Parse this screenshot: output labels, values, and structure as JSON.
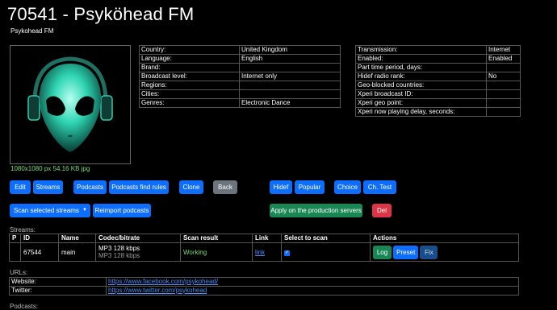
{
  "page": {
    "title": "70541 - Psyköhead FM",
    "subtitle": "Psykohead FM",
    "image_info": "1080x1080 px 54.16 KB jpg"
  },
  "info_left": [
    {
      "label": "Country:",
      "value": "United Kingdom"
    },
    {
      "label": "Language:",
      "value": "English"
    },
    {
      "label": "Brand:",
      "value": ""
    },
    {
      "label": "Broadcast level:",
      "value": "Internet only"
    },
    {
      "label": "Regions:",
      "value": ""
    },
    {
      "label": "Cities:",
      "value": ""
    },
    {
      "label": "Genres:",
      "value": "Electronic Dance"
    }
  ],
  "info_right": [
    {
      "label": "Transmission:",
      "value": "Internet"
    },
    {
      "label": "Enabled:",
      "value": "Enabled"
    },
    {
      "label": "Part time period, days:",
      "value": ""
    },
    {
      "label": "Hidef radio rank:",
      "value": "No"
    },
    {
      "label": "Geo-blocked countries:",
      "value": ""
    },
    {
      "label": "Xperi broadcast ID:",
      "value": ""
    },
    {
      "label": "Xperi geo point:",
      "value": ""
    },
    {
      "label": "Xperi now playing delay, seconds:",
      "value": ""
    }
  ],
  "buttons_row1": {
    "edit": "Edit",
    "streams": "Streams",
    "podcasts": "Podcasts",
    "podcasts_find_rules": "Podcasts find rules",
    "clone": "Clone",
    "back": "Back",
    "hidef": "Hidef",
    "popular": "Popular",
    "choice": "Choice",
    "ch_test": "Ch. Test"
  },
  "buttons_row2": {
    "scan_selected": "Scan selected streams",
    "reimport_podcasts": "Reimport podcasts",
    "apply_production": "Apply on the production servers",
    "del": "Del"
  },
  "streams": {
    "section_label": "Streams:",
    "headers": [
      "P",
      "ID",
      "Name",
      "Codec/bitrate",
      "Scan result",
      "Link",
      "Select to scan",
      "Actions"
    ],
    "rows": [
      {
        "p": "",
        "id": "67544",
        "name": "main",
        "codec1": "MP3 128 kbps",
        "codec2": "MP3 128 kbps",
        "scan_result": "Working",
        "link": "link",
        "actions": {
          "log": "Log",
          "preset": "Preset",
          "fix": "Fix"
        }
      }
    ]
  },
  "urls": {
    "section_label": "URLs:",
    "rows": [
      {
        "label": "Website:",
        "value": "https://www.facebook.com/psykohead/"
      },
      {
        "label": "Twitter:",
        "value": "https://www.twitter.com/psykohead"
      }
    ]
  },
  "podcasts": {
    "section_label": "Podcasts:"
  },
  "colors": {
    "background": "#000000",
    "primary_button": "#0d6efd",
    "secondary_button": "#6c757d",
    "success_button": "#198754",
    "danger_button": "#dc3545",
    "ok_text": "#7ddc7d",
    "link": "#4d8df5"
  }
}
